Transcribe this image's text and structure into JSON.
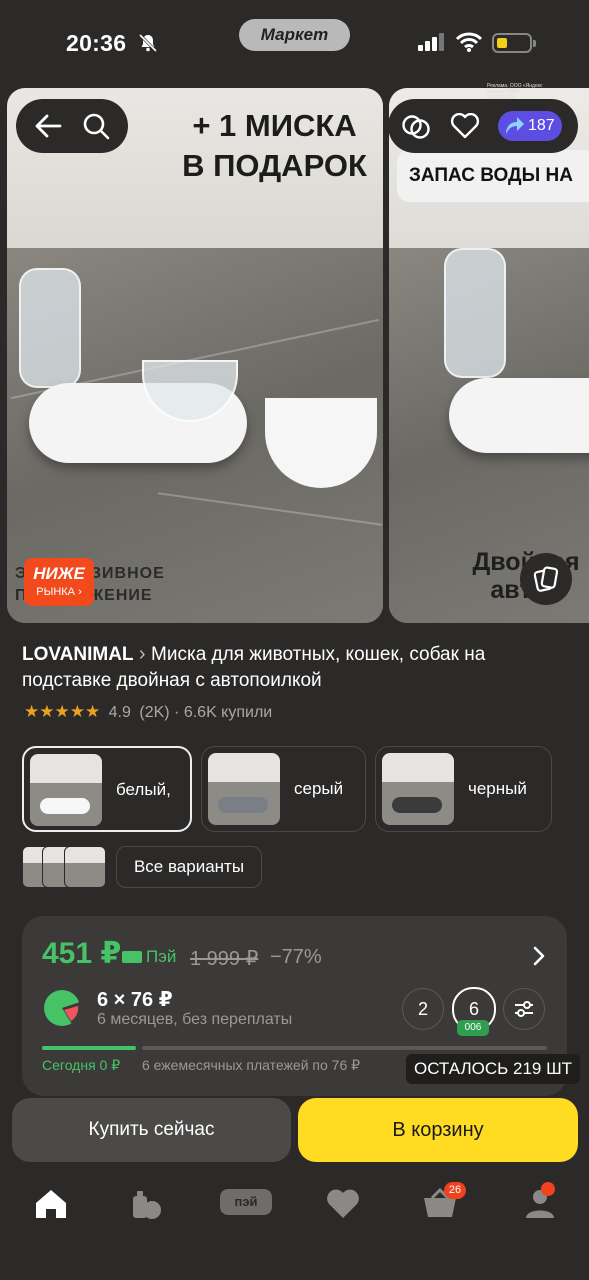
{
  "status_bar": {
    "time": "20:36",
    "center_pill": "Маркет"
  },
  "gallery": {
    "photo1": {
      "title_line1": "+ 1 МИСКА",
      "title_line2": "В ПОДАРОК",
      "bottom_line1": "ЭКСКЛЮЗИВНОЕ",
      "bottom_line2": "ПРЕДЛОЖЕНИЕ",
      "badge_main": "НИЖЕ",
      "badge_sub": "РЫНКА"
    },
    "photo2": {
      "banner": "ЗАПАС ВОДЫ НА",
      "bottom_line1": "Двойная",
      "bottom_line2": "автоп"
    },
    "legal_text": "Реклама. ООО «Яндекс Маркет» ИНН 9704254424",
    "favorites_count": "187"
  },
  "product": {
    "brand": "LOVANIMAL",
    "title": "Миска для животных, кошек, собак на подставке двойная с автопоилкой",
    "rating": "4.9",
    "reviews": "(2K)",
    "bought": "· 6.6K купили"
  },
  "variants": [
    {
      "label": "белый,",
      "selected": true
    },
    {
      "label": "серый",
      "selected": false
    },
    {
      "label": "черный",
      "selected": false
    }
  ],
  "all_variants_label": "Все варианты",
  "price_card": {
    "price": "451 ₽",
    "pay_label": "Пэй",
    "old_price": "1 999 ₽",
    "discount": "−77%",
    "split_amount": "6 × 76 ₽",
    "split_desc": "6 месяцев, без переплаты",
    "options": [
      "2",
      "6"
    ],
    "selected_code": "006",
    "today": "Сегодня 0 ₽",
    "payments": "6 ежемесячных платежей по 76 ₽",
    "remaining": "ОСТАЛОСЬ 219 ШТ"
  },
  "actions": {
    "buy_now": "Купить сейчас",
    "to_cart": "В корзину"
  },
  "nav": {
    "pay_label": "пэй",
    "cart_badge": "26"
  },
  "colors": {
    "accent_green": "#46c367",
    "cart_yellow": "#ffdc22",
    "badge_red": "#f0431d",
    "favorites_purple": "#5d4de3"
  }
}
